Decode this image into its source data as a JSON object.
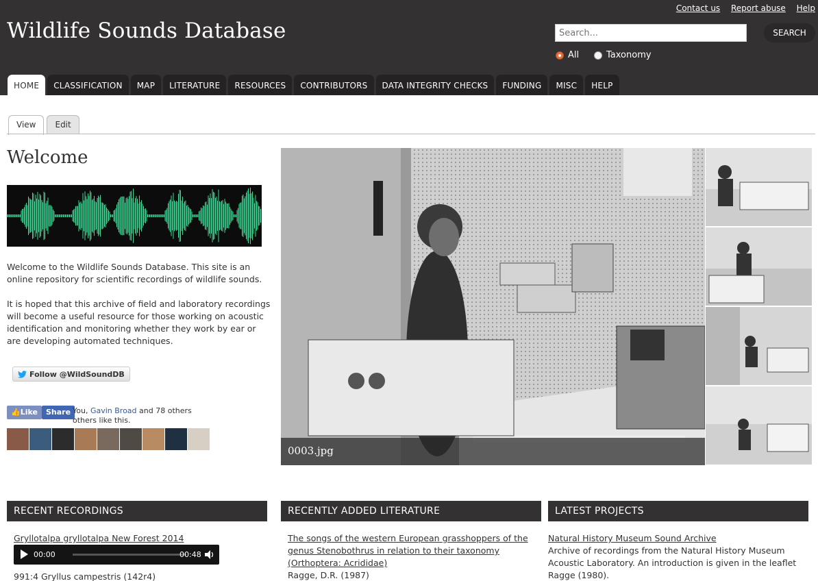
{
  "header": {
    "site_title": "Wildlife Sounds Database",
    "top_links": [
      "Contact us",
      "Report abuse",
      "Help"
    ],
    "search_placeholder": "Search...",
    "search_button": "SEARCH",
    "scope_options": [
      {
        "label": "All",
        "selected": true
      },
      {
        "label": "Taxonomy",
        "selected": false
      }
    ]
  },
  "nav": {
    "tabs": [
      "HOME",
      "CLASSIFICATION",
      "MAP",
      "LITERATURE",
      "RESOURCES",
      "CONTRIBUTORS",
      "DATA INTEGRITY CHECKS",
      "FUNDING",
      "MISC",
      "HELP"
    ],
    "active": "HOME"
  },
  "subtabs": {
    "items": [
      "View",
      "Edit"
    ],
    "active": "View"
  },
  "welcome": {
    "title": "Welcome",
    "paragraph1": "Welcome to the Wildlife Sounds Database. This site is an online repository for scientific recordings of wildlife sounds.",
    "paragraph2": "It is hoped that this archive of field and laboratory recordings will become a useful resource for those working on acoustic identification and monitoring whether they work by ear or are developing automated techniques.",
    "twitter_button": "Follow @WildSoundDB",
    "facebook": {
      "like": "Like",
      "share": "Share",
      "text_prefix": "You, ",
      "friend": "Gavin Broad",
      "text_suffix": " and 78 others others like this."
    }
  },
  "slideshow": {
    "caption": "0003.jpg"
  },
  "recent_recordings": {
    "title": "RECENT RECORDINGS",
    "item1": "Gryllotalpa gryllotalpa New Forest 2014",
    "audio_current": "00:00",
    "audio_duration": "00:48",
    "item2": "991:4 Gryllus campestris (142r4)"
  },
  "literature": {
    "title": "RECENTLY ADDED LITERATURE",
    "item_title": "The songs of the western European grasshoppers of the genus Stenobothrus in relation to their taxonomy (Orthoptera: Acrididae)",
    "item_author": "Ragge, D.R. (1987)"
  },
  "projects": {
    "title": "LATEST PROJECTS",
    "item_title": "Natural History Museum Sound Archive",
    "item_desc": "Archive of recordings from the Natural History Museum Acoustic Laboratory. An introduction is given in the leaflet Ragge (1980)."
  },
  "colors": {
    "header_bg": "#333131",
    "waveform": "#3ddc97",
    "radio_selected": "#e8703a",
    "facebook_blue": "#4267b2"
  }
}
